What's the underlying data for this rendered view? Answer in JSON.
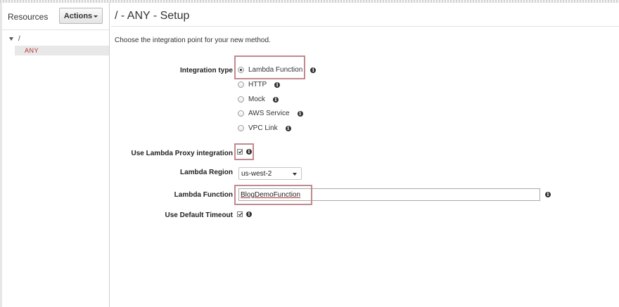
{
  "sidebar": {
    "title": "Resources",
    "actions_label": "Actions",
    "tree": {
      "root": "/",
      "method": "ANY"
    }
  },
  "page": {
    "title": "/ - ANY - Setup",
    "intro": "Choose the integration point for your new method."
  },
  "form": {
    "integration_type_label": "Integration type",
    "integration_options": [
      {
        "label": "Lambda Function",
        "selected": true
      },
      {
        "label": "HTTP",
        "selected": false
      },
      {
        "label": "Mock",
        "selected": false
      },
      {
        "label": "AWS Service",
        "selected": false
      },
      {
        "label": "VPC Link",
        "selected": false
      }
    ],
    "proxy_label": "Use Lambda Proxy integration",
    "proxy_checked": true,
    "region_label": "Lambda Region",
    "region_value": "us-west-2",
    "function_label": "Lambda Function",
    "function_value": "BlogDemoFunction",
    "timeout_label": "Use Default Timeout",
    "timeout_checked": true
  },
  "icons": {
    "info": "info-icon",
    "check": "check-icon",
    "caret": "caret-down-icon"
  },
  "colors": {
    "highlight": "#c08a8e",
    "method_text": "#bb3333",
    "selected_tree_bg": "#e8e8e8"
  }
}
